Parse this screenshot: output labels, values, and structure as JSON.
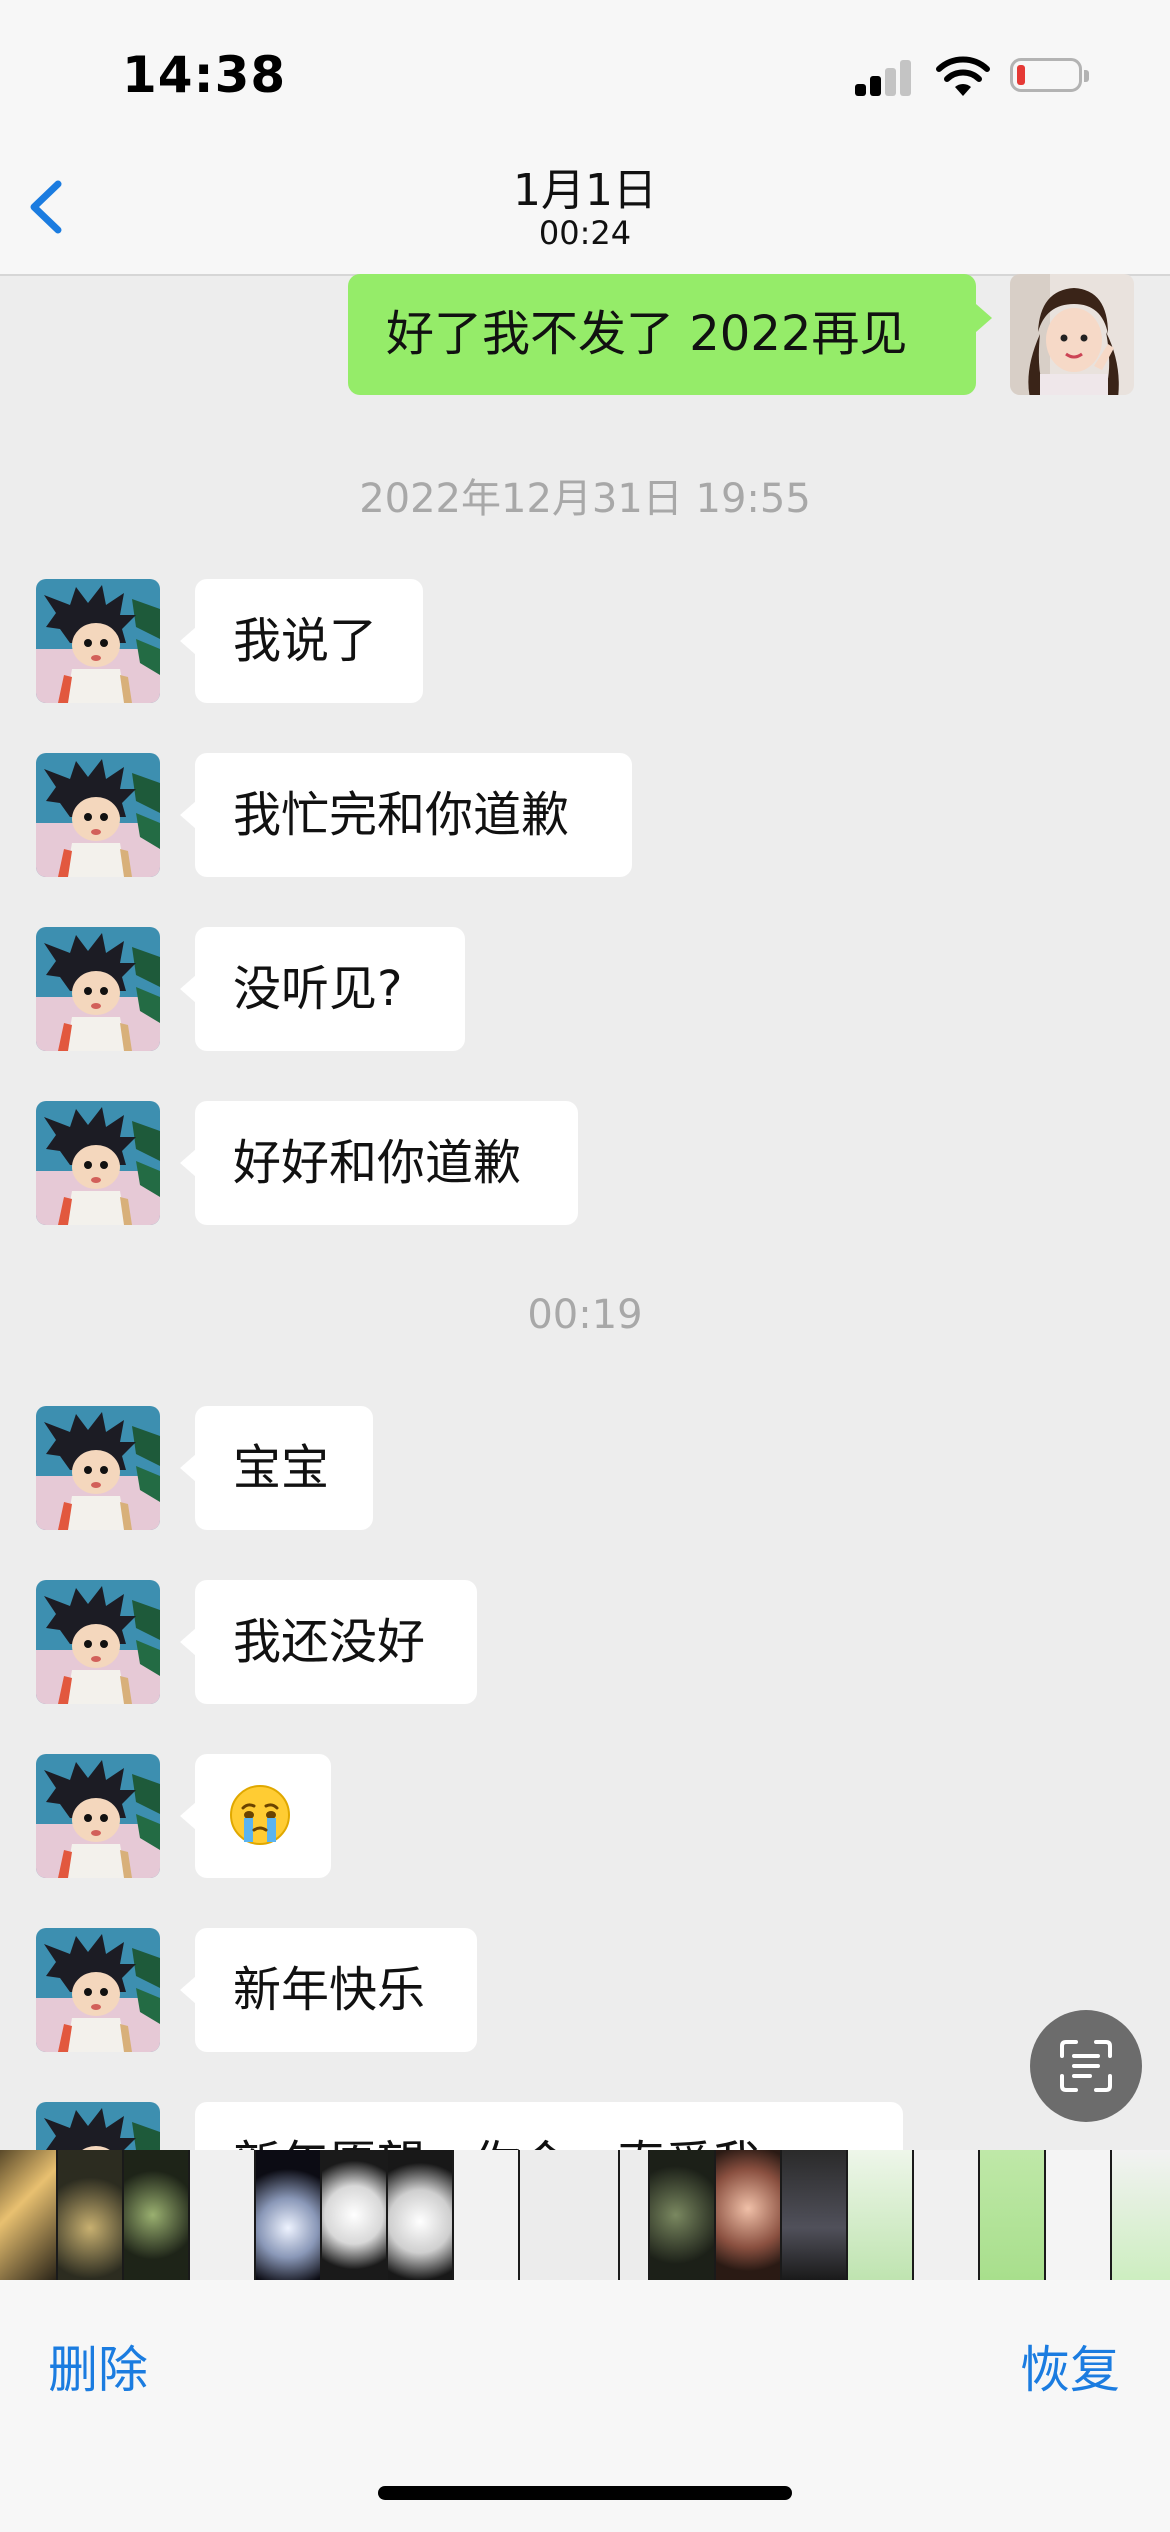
{
  "status_bar": {
    "time": "14:38"
  },
  "nav": {
    "title": "1月1日",
    "subtitle": "00:24"
  },
  "messages": [
    {
      "dir": "out",
      "text": "好了我不发了 2022再见"
    },
    {
      "dir": "in",
      "text": "我说了"
    },
    {
      "dir": "in",
      "text": "我忙完和你道歉"
    },
    {
      "dir": "in",
      "text": "没听见?"
    },
    {
      "dir": "in",
      "text": "好好和你道歉"
    },
    {
      "dir": "in",
      "text": "宝宝"
    },
    {
      "dir": "in",
      "text": "我还没好"
    },
    {
      "dir": "in",
      "emoji": "crying-face"
    },
    {
      "dir": "in",
      "text": "新年快乐"
    },
    {
      "dir": "in",
      "text": "新年愿望一你会一直爱我"
    }
  ],
  "timestamps": [
    "2022年12月31日 19:55",
    "00:19"
  ],
  "toolbar": {
    "delete_label": "删除",
    "restore_label": "恢复"
  },
  "icons": {
    "back": "chevron-left-icon",
    "scan": "text-scan-icon"
  },
  "colors": {
    "accent": "#1b7ce0",
    "outgoing_bubble": "#95ec69",
    "incoming_bubble": "#ffffff",
    "background": "#ededed",
    "battery_low": "#e53935"
  }
}
